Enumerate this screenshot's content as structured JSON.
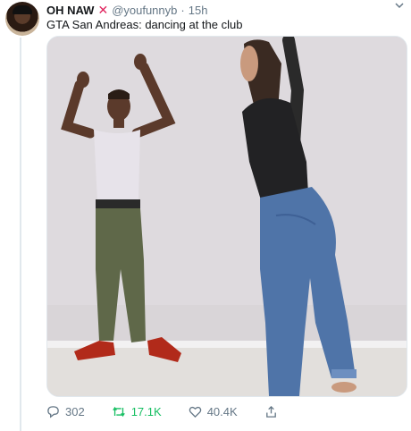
{
  "tweet": {
    "display_name": "OH NAW",
    "display_name_emoji": "✕",
    "handle": "@youfunnyb",
    "separator": "·",
    "time": "15h",
    "text": "GTA San Andreas: dancing at the club",
    "more_icon": "chevron-down-icon"
  },
  "actions": {
    "reply_count": "302",
    "retweet_count": "17.1K",
    "like_count": "40.4K",
    "retweet_color": "#17bf63",
    "muted_color": "#657786"
  },
  "colors": {
    "x_mark": "#e0245e",
    "thread_line": "#e1e8ed"
  }
}
